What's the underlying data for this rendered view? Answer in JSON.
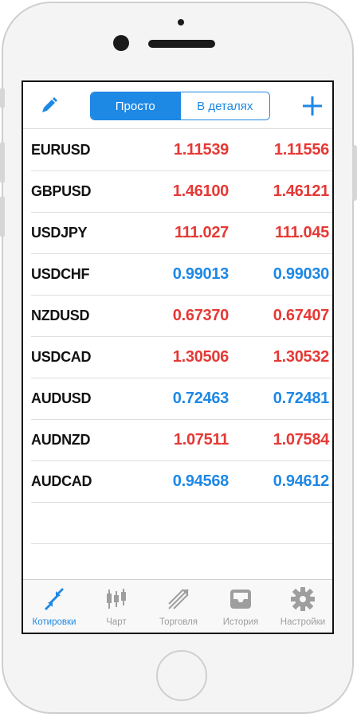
{
  "header": {
    "segments": [
      "Просто",
      "В деталях"
    ],
    "edit_icon": "pencil-icon",
    "add_icon": "plus-icon"
  },
  "quotes": [
    {
      "symbol": "EURUSD",
      "bid": "1.11539",
      "ask": "1.11556",
      "color": "#e53935"
    },
    {
      "symbol": "GBPUSD",
      "bid": "1.46100",
      "ask": "1.46121",
      "color": "#e53935"
    },
    {
      "symbol": "USDJPY",
      "bid": "111.027",
      "ask": "111.045",
      "color": "#e53935"
    },
    {
      "symbol": "USDCHF",
      "bid": "0.99013",
      "ask": "0.99030",
      "color": "#1e88e5"
    },
    {
      "symbol": "NZDUSD",
      "bid": "0.67370",
      "ask": "0.67407",
      "color": "#e53935"
    },
    {
      "symbol": "USDCAD",
      "bid": "1.30506",
      "ask": "1.30532",
      "color": "#e53935"
    },
    {
      "symbol": "AUDUSD",
      "bid": "0.72463",
      "ask": "0.72481",
      "color": "#1e88e5"
    },
    {
      "symbol": "AUDNZD",
      "bid": "1.07511",
      "ask": "1.07584",
      "color": "#e53935"
    },
    {
      "symbol": "AUDCAD",
      "bid": "0.94568",
      "ask": "0.94612",
      "color": "#1e88e5"
    }
  ],
  "tabbar": {
    "tabs": [
      {
        "label": "Котировки",
        "icon": "quotes-icon",
        "active": true
      },
      {
        "label": "Чарт",
        "icon": "candlestick-chart-icon",
        "active": false
      },
      {
        "label": "Торговля",
        "icon": "trade-icon",
        "active": false
      },
      {
        "label": "История",
        "icon": "history-inbox-icon",
        "active": false
      },
      {
        "label": "Настройки",
        "icon": "settings-gear-icon",
        "active": false
      }
    ]
  },
  "colors": {
    "accent": "#1e88e5",
    "down": "#e53935",
    "up": "#1e88e5",
    "inactive_tab": "#9e9e9e"
  }
}
